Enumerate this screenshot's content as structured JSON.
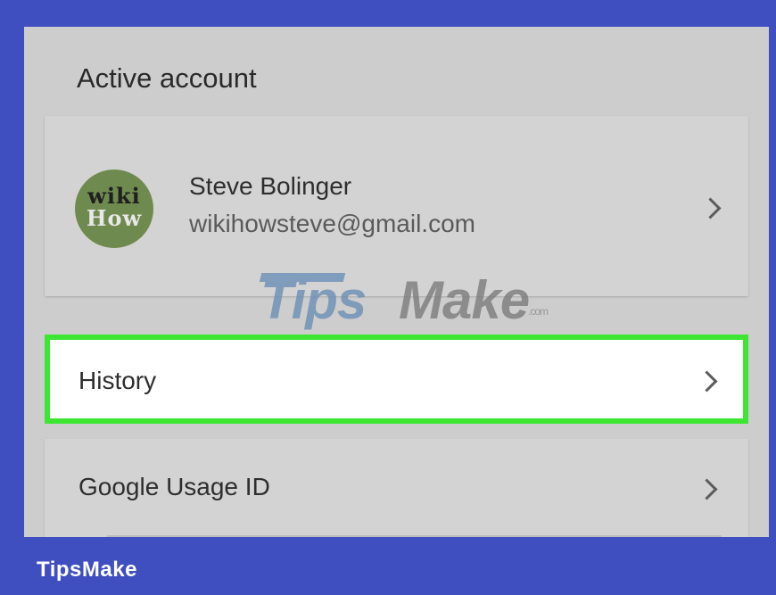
{
  "section_title": "Active account",
  "account": {
    "avatar": {
      "line1": "wiki",
      "line2": "How"
    },
    "name": "Steve Bolinger",
    "email": "wikihowsteve@gmail.com"
  },
  "watermark": {
    "part1": "Tips",
    "part2": "Make",
    "suffix": ".com"
  },
  "menu": {
    "history": {
      "label": "History"
    },
    "usage_id": {
      "label": "Google Usage ID"
    }
  },
  "footer": {
    "brand": "TipsMake"
  },
  "colors": {
    "frame": "#3f4fc0",
    "screen": "#cdcdcd",
    "card": "#d3d3d3",
    "highlight": "#3ee634",
    "avatar_bg": "#6f8a4e"
  },
  "icons": {
    "chevron": "chevron-right-icon"
  }
}
